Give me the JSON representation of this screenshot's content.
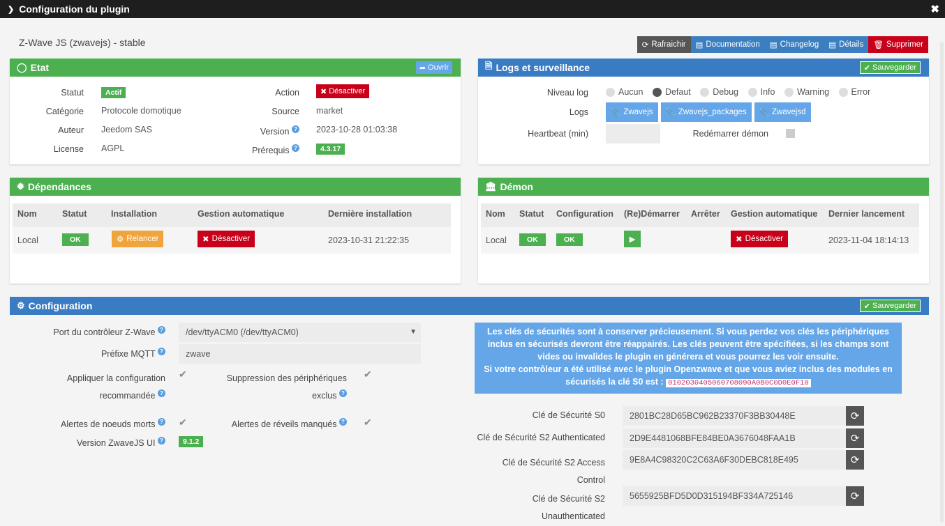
{
  "window": {
    "title": "Configuration du plugin",
    "chevron_icon": "chevron-right-icon",
    "close_icon": "close-icon"
  },
  "plugin": {
    "name": "Z-Wave JS (zwavejs) - stable"
  },
  "toolbar": {
    "refresh": "Rafraichir",
    "documentation": "Documentation",
    "changelog": "Changelog",
    "details": "Détails",
    "delete": "Supprimer"
  },
  "etat": {
    "title": "Etat",
    "open_btn": "Ouvrir",
    "statut_label": "Statut",
    "statut_value": "Actif",
    "categorie_label": "Catégorie",
    "categorie_value": "Protocole domotique",
    "auteur_label": "Auteur",
    "auteur_value": "Jeedom SAS",
    "license_label": "License",
    "license_value": "AGPL",
    "action_label": "Action",
    "action_btn": "Désactiver",
    "source_label": "Source",
    "source_value": "market",
    "version_label": "Version",
    "version_value": "2023-10-28 01:03:38",
    "prerequis_label": "Prérequis",
    "prerequis_value": "4.3.17"
  },
  "logs": {
    "title": "Logs et surveillance",
    "save_btn": "Sauvegarder",
    "niveau_label": "Niveau log",
    "levels": [
      "Aucun",
      "Defaut",
      "Debug",
      "Info",
      "Warning",
      "Error"
    ],
    "selected_level": "Defaut",
    "logs_label": "Logs",
    "log_buttons": [
      "Zwavejs",
      "Zwavejs_packages",
      "Zwavejsd"
    ],
    "heartbeat_label": "Heartbeat (min)",
    "heartbeat_value": "",
    "restart_label": "Redémarrer démon"
  },
  "dependances": {
    "title": "Dépendances",
    "headers": [
      "Nom",
      "Statut",
      "Installation",
      "Gestion automatique",
      "Dernière installation"
    ],
    "row": {
      "nom": "Local",
      "statut": "OK",
      "installation": "Relancer",
      "gestion": "Désactiver",
      "derniere": "2023-10-31 21:22:35"
    }
  },
  "demon": {
    "title": "Démon",
    "headers": [
      "Nom",
      "Statut",
      "Configuration",
      "(Re)Démarrer",
      "Arrêter",
      "Gestion automatique",
      "Dernier lancement"
    ],
    "row": {
      "nom": "Local",
      "statut": "OK",
      "configuration": "OK",
      "gestion": "Désactiver",
      "dernier": "2023-11-04 18:14:13"
    }
  },
  "configuration": {
    "title": "Configuration",
    "save_btn": "Sauvegarder",
    "port_label": "Port du contrôleur Z-Wave",
    "port_value": "/dev/ttyACM0 (/dev/ttyACM0)",
    "mqtt_label": "Préfixe MQTT",
    "mqtt_value": "zwave",
    "apply_label_1": "Appliquer la configuration",
    "apply_label_2": "recommandée",
    "suppression_label_1": "Suppression des périphériques",
    "suppression_label_2": "exclus",
    "alertes_noeuds_label": "Alertes de noeuds morts",
    "alertes_reveils_label": "Alertes de réveils manqués",
    "version_ui_label": "Version ZwaveJS UI",
    "version_ui_value": "9.1.2",
    "info_text_1": "Les clés de sécurités sont à conserver précieusement. Si vous perdez vos clés les périphériques inclus en sécurisés devront être réappairés. Les clés peuvent être spécifiées, si les champs sont vides ou invalides le plugin en générera et vous pourrez les voir ensuite.",
    "info_text_2": "Si votre contrôleur a été utilisé avec le plugin Openzwave et que vous aviez inclus des modules en sécurisés la clé S0 est :",
    "info_code": "0102030405060708090A0B0C0D0E0F10",
    "keys": [
      {
        "label_1": "Clé de Sécurité S0",
        "label_2": "",
        "value": "2801BC28D65BC962B23370F3BB30448E"
      },
      {
        "label_1": "Clé de Sécurité S2 Authenticated",
        "label_2": "",
        "value": "2D9E4481068BFE84BE0A3676048FAA1B"
      },
      {
        "label_1": "Clé de Sécurité S2 Access",
        "label_2": "Control",
        "value": "9E8A4C98320C2C63A6F30DEBC818E495"
      },
      {
        "label_1": "Clé de Sécurité S2",
        "label_2": "Unauthenticated",
        "value": "5655925BFD5D0D315194BF334A725146"
      }
    ]
  },
  "colors": {
    "green": "#4caf50",
    "blue": "#3a7cc4",
    "red": "#c9001a",
    "orange": "#f0a43c",
    "dark": "#555555",
    "light_blue": "#64a6e8"
  }
}
